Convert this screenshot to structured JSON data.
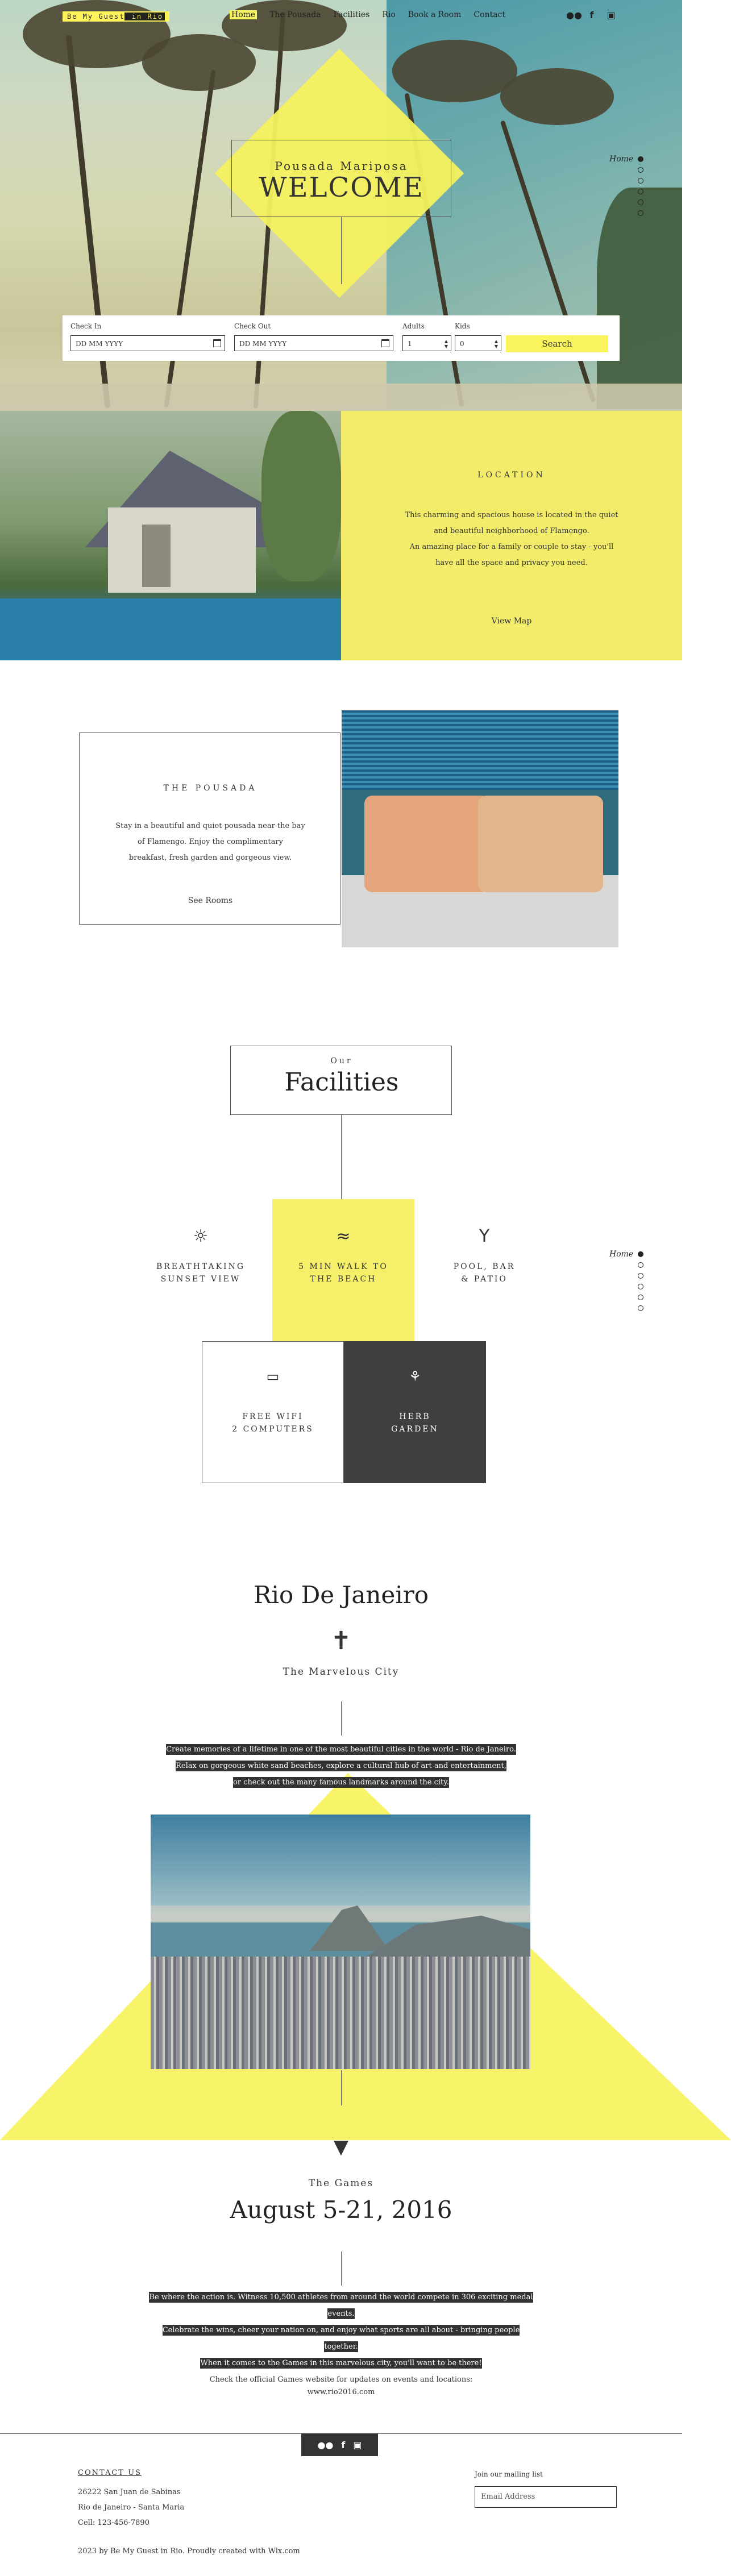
{
  "header": {
    "logo_part1": "Be My Guest",
    "logo_part2": " in Rio",
    "nav": [
      "Home",
      "The Pousada",
      "Facilities",
      "Rio",
      "Book a Room",
      "Contact"
    ],
    "social_icons": [
      "tripadvisor-icon",
      "facebook-icon",
      "instagram-icon"
    ]
  },
  "hero": {
    "subtitle": "Pousada Mariposa",
    "title": "WELCOME",
    "side_nav_label": "Home",
    "accent_color": "#f6f15f"
  },
  "booking": {
    "checkin_label": "Check In",
    "checkin_placeholder": "DD MM YYYY",
    "checkout_label": "Check Out",
    "checkout_placeholder": "DD MM YYYY",
    "adults_label": "Adults",
    "adults_value": "1",
    "kids_label": "Kids",
    "kids_value": "0",
    "search_label": "Search"
  },
  "location": {
    "label": "LOCATION",
    "line1": "This charming and spacious house is located in the quiet",
    "line2": "and beautiful neighborhood of Flamengo.",
    "line3": "An amazing place for a family or couple to stay - you'll",
    "line4": "have all the space and privacy you need.",
    "link": "View Map"
  },
  "pousada": {
    "label": "THE POUSADA",
    "line1": "Stay in a beautiful and quiet pousada near the bay",
    "line2": "of Flamengo. Enjoy the complimentary",
    "line3": "breakfast, fresh garden and gorgeous view.",
    "link": "See Rooms"
  },
  "facilities": {
    "over": "Our",
    "title": "Facilities",
    "side_nav_label": "Home",
    "items": [
      {
        "line1": "BREATHTAKING",
        "line2": "SUNSET VIEW",
        "icon": "sun-icon"
      },
      {
        "line1": "5 MIN WALK TO",
        "line2": "THE BEACH",
        "icon": "waves-icon"
      },
      {
        "line1": "POOL, BAR",
        "line2": "& PATIO",
        "icon": "cocktail-icon"
      },
      {
        "line1": "FREE WIFI",
        "line2": "2 COMPUTERS",
        "icon": "laptop-icon"
      },
      {
        "line1": "HERB",
        "line2": "GARDEN",
        "icon": "plant-icon"
      }
    ]
  },
  "rio": {
    "title": "Rio De Janeiro",
    "subtitle": "The Marvelous City",
    "line1": "Create memories of a lifetime in one of the most beautiful cities in the world - Rio de Janeiro.",
    "line2": "Relax on gorgeous white sand beaches, explore a cultural hub of art and entertainment,",
    "line3": "or check out  the many famous landmarks around the city."
  },
  "games": {
    "label": "The Games",
    "date": "August 5-21, 2016",
    "line1": "Be where the action is. Witness 10,500 athletes from around the world compete in 306 exciting medal events.",
    "line2": "Celebrate the wins, cheer your nation on, and enjoy what sports are all about - bringing people together.",
    "line3": "When it comes to the Games in this marvelous city, you'll want to be there!",
    "note1": "Check the official Games website for updates on events and locations:",
    "note2": "www.rio2016.com"
  },
  "footer": {
    "contact_title": "CONTACT US",
    "address1": "26222 San Juan de Sabinas",
    "address2": "Rio de Janeiro - Santa Maria",
    "phone": "Cell: 123-456-7890",
    "copyright": "2023 by Be My Guest in Rio. Proudly created with Wix.com",
    "mailing_label": "Join our mailing list",
    "email_placeholder": "Email Address"
  }
}
